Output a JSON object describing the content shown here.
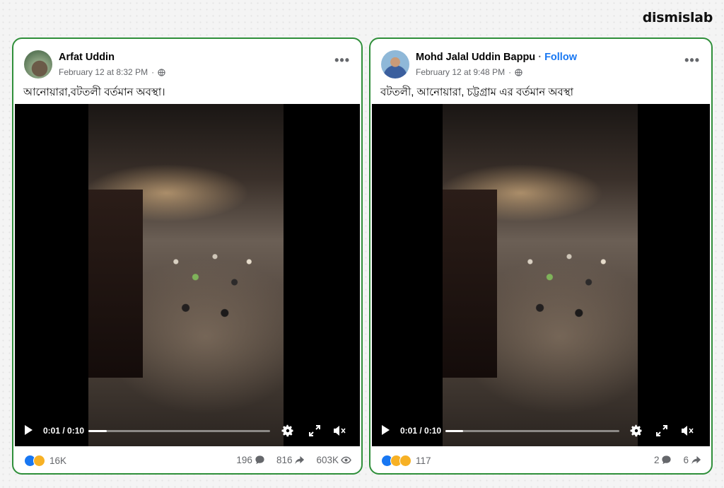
{
  "brand": "dismislab",
  "posts": [
    {
      "author": "Arfat Uddin",
      "follow": "",
      "date": "February 12 at 8:32 PM",
      "dot": "·",
      "more": "•••",
      "caption": "আনোয়ারা,বটতলী বর্তমান অবস্থা।",
      "video": {
        "time": "0:01 / 0:10",
        "progress_fraction": 0.1
      },
      "reactions": [
        "like",
        "haha"
      ],
      "reaction_count": "16K",
      "comments": "196",
      "shares": "816",
      "views": "603K"
    },
    {
      "author": "Mohd Jalal Uddin Bappu",
      "follow": "Follow",
      "date": "February 12 at 9:48 PM",
      "dot": "·",
      "more": "•••",
      "caption": "বটতলী, আনোয়ারা, চট্টগ্রাম এর বর্তমান অবস্থা",
      "video": {
        "time": "0:01 / 0:10",
        "progress_fraction": 0.1
      },
      "reactions": [
        "like",
        "haha",
        "sad"
      ],
      "reaction_count": "117",
      "comments": "2",
      "shares": "6",
      "views": ""
    }
  ],
  "colors": {
    "card_border": "#2f8f3a",
    "follow": "#1877f2",
    "like": "#1877f2"
  }
}
